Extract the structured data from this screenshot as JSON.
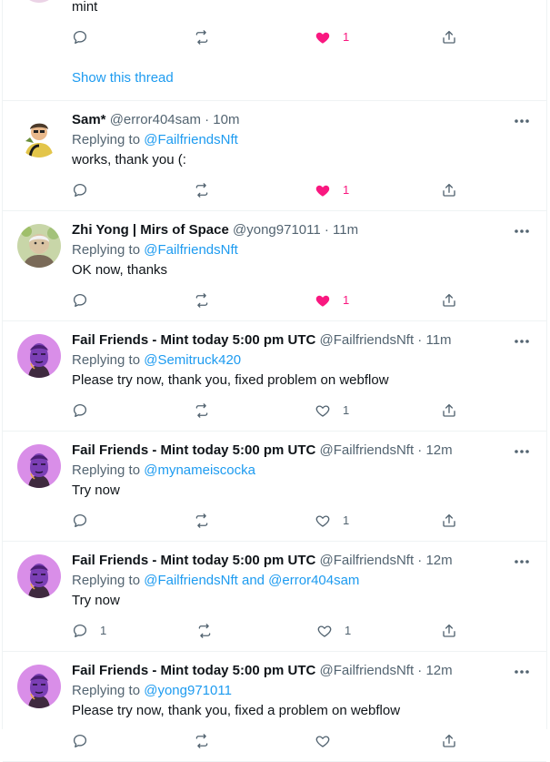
{
  "top": {
    "partial_text": "mint",
    "like_count": "1",
    "show_thread": "Show this thread"
  },
  "tweets": [
    {
      "name": "Sam*",
      "handle": "@error404sam",
      "time": "· 10m",
      "replying_prefix": "Replying to",
      "replying_to": "@FailfriendsNft",
      "text": "works, thank you (:",
      "reply_count": "",
      "like_count": "1",
      "liked": true
    },
    {
      "name": "Zhi Yong | Mirs of Space",
      "handle": "@yong971011",
      "time": "· 11m",
      "replying_prefix": "Replying to",
      "replying_to": "@FailfriendsNft",
      "text": "OK now, thanks",
      "reply_count": "",
      "like_count": "1",
      "liked": true
    },
    {
      "name": "Fail Friends - Mint today 5:00 pm UTC",
      "handle": "@FailfriendsNft",
      "time": "· 11m",
      "replying_prefix": "Replying to",
      "replying_to": "@Semitruck420",
      "text": "Please try now, thank you, fixed problem on webflow",
      "reply_count": "",
      "like_count": "1",
      "liked": false
    },
    {
      "name": "Fail Friends - Mint today 5:00 pm UTC",
      "handle": "@FailfriendsNft",
      "time": "· 12m",
      "replying_prefix": "Replying to",
      "replying_to": "@mynameiscocka",
      "text": "Try now",
      "reply_count": "",
      "like_count": "1",
      "liked": false
    },
    {
      "name": "Fail Friends - Mint today 5:00 pm UTC",
      "handle": "@FailfriendsNft",
      "time": "· 12m",
      "replying_prefix": "Replying to",
      "replying_to": "@FailfriendsNft and @error404sam",
      "text": "Try now",
      "reply_count": "1",
      "like_count": "1",
      "liked": false
    },
    {
      "name": "Fail Friends - Mint today 5:00 pm UTC",
      "handle": "@FailfriendsNft",
      "time": "· 12m",
      "replying_prefix": "Replying to",
      "replying_to": "@yong971011",
      "text": "Please try now, thank you, fixed a problem on webflow",
      "reply_count": "",
      "like_count": "",
      "liked": false
    }
  ],
  "colors": {
    "accent": "#1d9bf0",
    "like": "#f91880",
    "muted": "#536471",
    "border": "#eff3f4",
    "fail_friends_avatar": "#d98ee8"
  },
  "icons": {
    "reply": "reply-icon",
    "retweet": "retweet-icon",
    "like": "heart-icon",
    "share": "share-icon",
    "more": "more-icon"
  }
}
